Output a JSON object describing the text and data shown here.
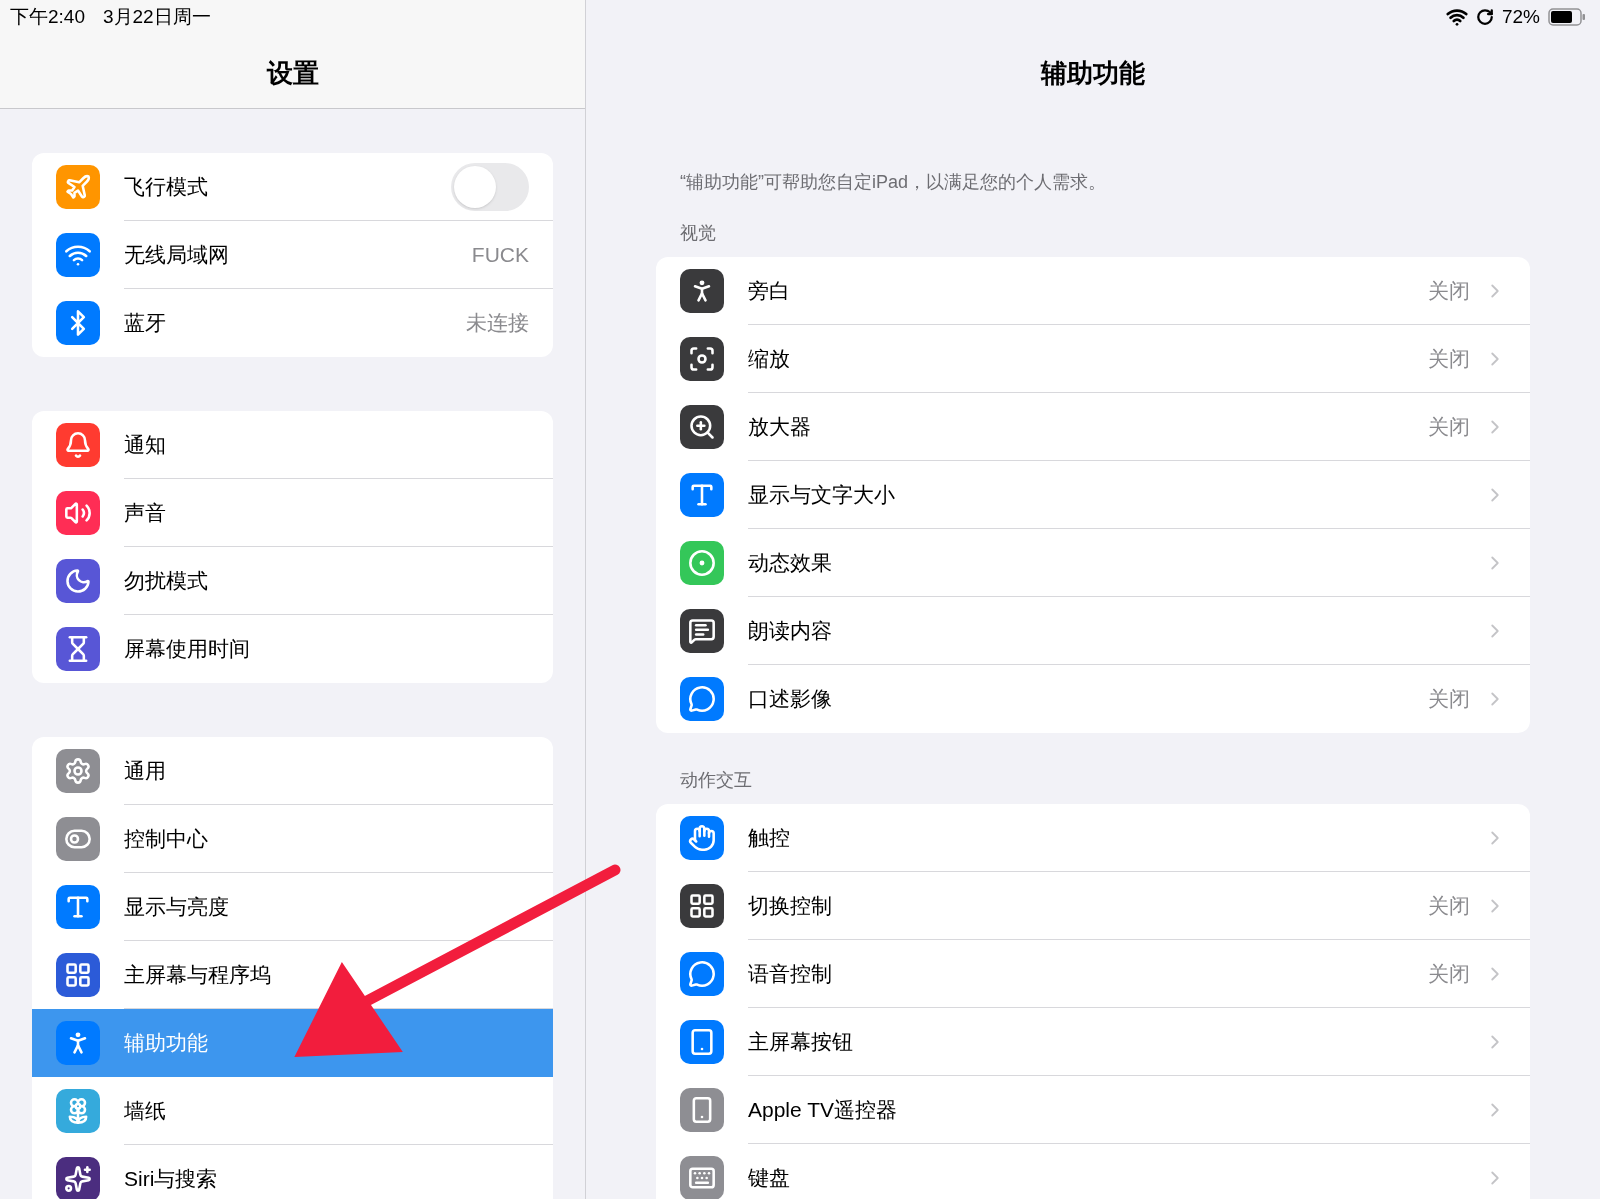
{
  "status_bar": {
    "time": "下午2:40",
    "date": "3月22日周一",
    "battery": "72%"
  },
  "sidebar": {
    "title": "设置",
    "groups": [
      [
        {
          "label": "飞行模式",
          "kind": "toggle",
          "on": false,
          "selected": false
        },
        {
          "label": "无线局域网",
          "kind": "value",
          "value": "FUCK",
          "selected": false
        },
        {
          "label": "蓝牙",
          "kind": "value",
          "value": "未连接",
          "selected": false
        }
      ],
      [
        {
          "label": "通知",
          "kind": "nav",
          "selected": false
        },
        {
          "label": "声音",
          "kind": "nav",
          "selected": false
        },
        {
          "label": "勿扰模式",
          "kind": "nav",
          "selected": false
        },
        {
          "label": "屏幕使用时间",
          "kind": "nav",
          "selected": false
        }
      ],
      [
        {
          "label": "通用",
          "kind": "nav",
          "selected": false
        },
        {
          "label": "控制中心",
          "kind": "nav",
          "selected": false
        },
        {
          "label": "显示与亮度",
          "kind": "nav",
          "selected": false
        },
        {
          "label": "主屏幕与程序坞",
          "kind": "nav",
          "selected": false
        },
        {
          "label": "辅助功能",
          "kind": "nav",
          "selected": true
        },
        {
          "label": "墙纸",
          "kind": "nav",
          "selected": false
        },
        {
          "label": "Siri与搜索",
          "kind": "nav",
          "selected": false
        }
      ]
    ]
  },
  "detail": {
    "title": "辅助功能",
    "description": "“辅助功能”可帮助您自定iPad，以满足您的个人需求。",
    "sections": [
      {
        "header": "视觉",
        "rows": [
          {
            "label": "旁白",
            "value": "关闭"
          },
          {
            "label": "缩放",
            "value": "关闭"
          },
          {
            "label": "放大器",
            "value": "关闭"
          },
          {
            "label": "显示与文字大小"
          },
          {
            "label": "动态效果"
          },
          {
            "label": "朗读内容"
          },
          {
            "label": "口述影像",
            "value": "关闭"
          }
        ]
      },
      {
        "header": "动作交互",
        "rows": [
          {
            "label": "触控"
          },
          {
            "label": "切换控制",
            "value": "关闭"
          },
          {
            "label": "语音控制",
            "value": "关闭"
          },
          {
            "label": "主屏幕按钮"
          },
          {
            "label": "Apple TV遥控器"
          },
          {
            "label": "键盘"
          }
        ]
      }
    ]
  }
}
